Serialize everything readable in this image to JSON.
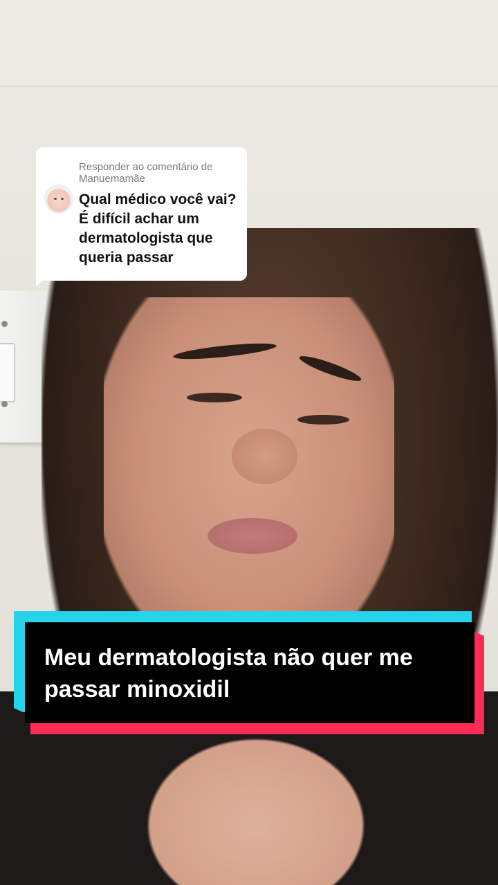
{
  "reply": {
    "header": "Responder ao comentário de Manuemamãe",
    "comment": "Qual médico você vai? É difícil achar um dermatologista que queria passar"
  },
  "caption": {
    "text": "Meu dermatologista não quer me passar minoxidil"
  },
  "colors": {
    "caption_bg": "#000000",
    "caption_cyan": "#25d4ea",
    "caption_red": "#fe2c55",
    "bubble_bg": "#ffffff"
  }
}
